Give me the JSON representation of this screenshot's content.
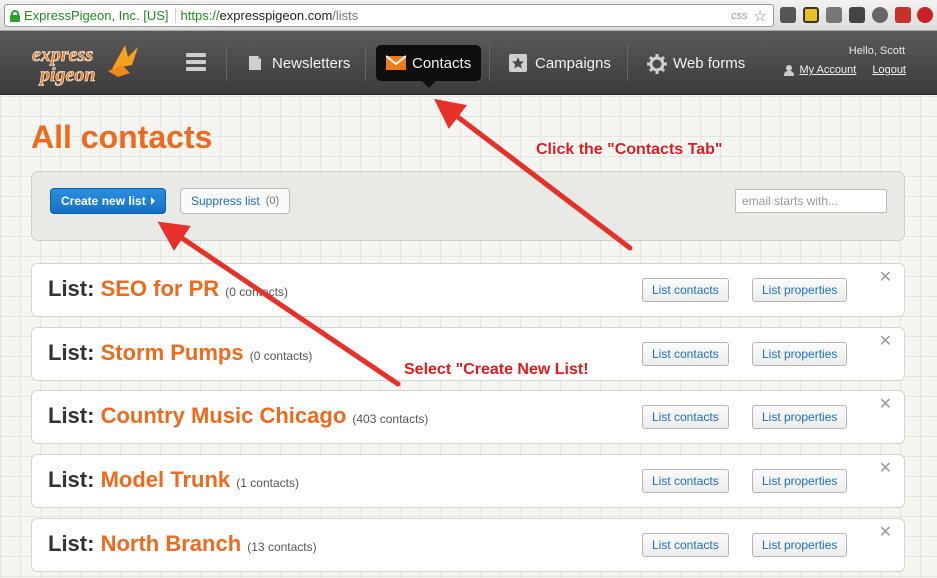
{
  "browser": {
    "ev_label": "ExpressPigeon, Inc. [US]",
    "url_scheme": "https://",
    "url_host": "expresspigeon.com",
    "url_path": "/lists",
    "css_tag": "css"
  },
  "nav": {
    "items": [
      {
        "label": "Newsletters",
        "icon": "newsletter-icon"
      },
      {
        "label": "Contacts",
        "icon": "envelope-icon"
      },
      {
        "label": "Campaigns",
        "icon": "star-icon"
      },
      {
        "label": "Web forms",
        "icon": "gear-icon"
      }
    ],
    "greeting": "Hello, Scott",
    "my_account": "My Account",
    "logout": "Logout",
    "logo_text_1": "express",
    "logo_text_2": "pigeon"
  },
  "page": {
    "title": "All contacts",
    "create_list": "Create new list",
    "suppress_list": "Suppress list",
    "suppress_count": "(0)",
    "search_placeholder": "email starts with..."
  },
  "lists": [
    {
      "prefix": "List:",
      "name": "SEO for PR",
      "count": "(0 contacts)",
      "list_contacts": "List contacts",
      "list_properties": "List properties"
    },
    {
      "prefix": "List:",
      "name": "Storm Pumps",
      "count": "(0 contacts)",
      "list_contacts": "List contacts",
      "list_properties": "List properties"
    },
    {
      "prefix": "List:",
      "name": "Country Music Chicago",
      "count": "(403 contacts)",
      "list_contacts": "List contacts",
      "list_properties": "List properties"
    },
    {
      "prefix": "List:",
      "name": "Model Trunk",
      "count": "(1 contacts)",
      "list_contacts": "List contacts",
      "list_properties": "List properties"
    },
    {
      "prefix": "List:",
      "name": "North Branch",
      "count": "(13 contacts)",
      "list_contacts": "List contacts",
      "list_properties": "List properties"
    }
  ],
  "annotations": {
    "contacts_tab": "Click the \"Contacts Tab\"",
    "create_list": "Select \"Create New List!"
  },
  "colors": {
    "accent_orange": "#ee6a1c",
    "primary_blue": "#1570c2",
    "annotation_red": "#e21a1a"
  }
}
